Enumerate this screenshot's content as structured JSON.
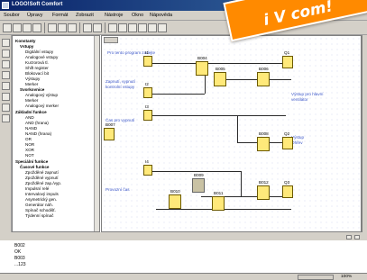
{
  "window": {
    "title": "LOGO!Soft Comfort"
  },
  "badge": {
    "text": "i V com!"
  },
  "menu": [
    "Soubor",
    "Úpravy",
    "Formát",
    "Zobrazit",
    "Nástroje",
    "Okno",
    "Nápověda"
  ],
  "tree": {
    "items": [
      "Konstanty",
      "Vstupy",
      "Digitální vstupy",
      "Analogové vstupy",
      "Kurzorová tl.",
      "Shift register",
      "Blokovací bit",
      "Výstupy",
      "Merker",
      "Svorkovnice",
      "Analogový výstup",
      "Merker",
      "Analogový merker",
      "Základní funkce",
      "AND",
      "AND (hrana)",
      "NAND",
      "NAND (hrana)",
      "OR",
      "NOR",
      "XOR",
      "NOT",
      "Speciální funkce",
      "Časové funkce",
      "Zpožděné zapnutí",
      "Zpožděné vypnutí",
      "Zpožděné zap./vyp.",
      "Impulsní relé",
      "Intervalový impuls",
      "Asymetrický gen.",
      "Generátor náh.",
      "Spínač schodišť.",
      "Týdenní spínač"
    ]
  },
  "canvas": {
    "notes": [
      "Pro tento program zadejte",
      "Zapnutí, vypnutí",
      "kontrolní vstupy",
      "Čas pro vypnutí",
      "Výstup pro hlavní",
      "ventilátor",
      "Výstup",
      "Ohřev",
      "Provozní čas"
    ],
    "blocks": [
      "I1",
      "Q1",
      "I2",
      "B004",
      "B005",
      "B006",
      "I3",
      "B007",
      "B008",
      "Q2",
      "I4",
      "B009",
      "B010",
      "B011",
      "B012",
      "Q3"
    ]
  },
  "console": {
    "lines": [
      "B002",
      "OK",
      "B003",
      "...123"
    ]
  },
  "status": {
    "left": "",
    "right": "100%"
  }
}
